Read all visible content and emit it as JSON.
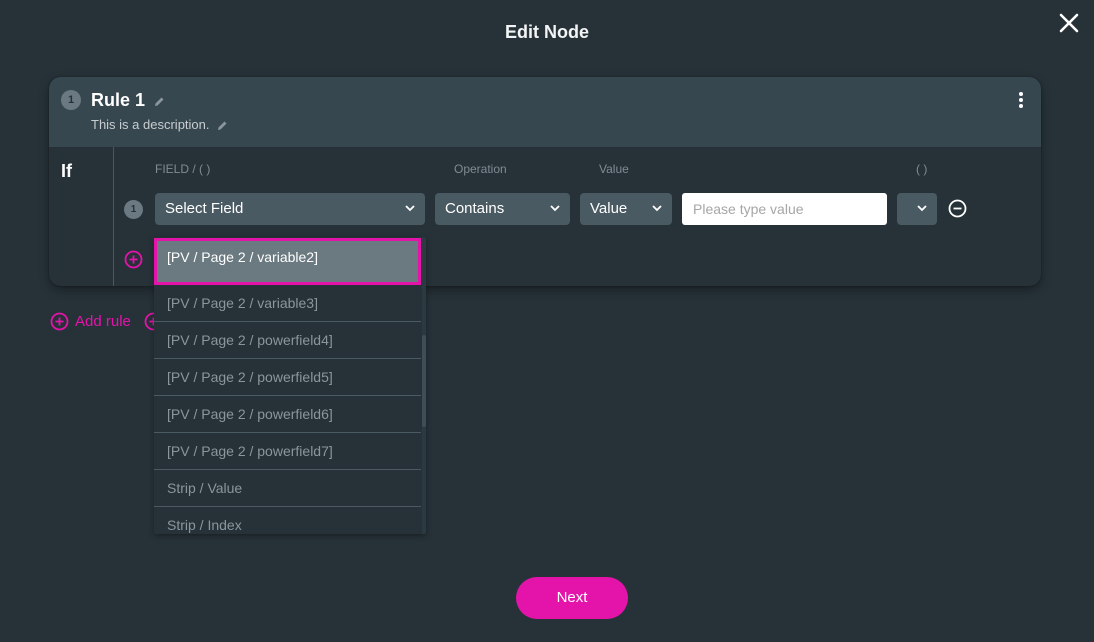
{
  "dialog": {
    "title": "Edit Node",
    "close_icon": "close-icon"
  },
  "rule": {
    "number": "1",
    "name": "Rule 1",
    "description": "This is a description.",
    "menu_icon": "kebab-menu-icon",
    "condition_keyword": "If",
    "columns": {
      "field": "FIELD / ( )",
      "operation": "Operation",
      "value": "Value",
      "paren": "( )"
    },
    "conditions": [
      {
        "number": "1",
        "field": "Select Field",
        "operation": "Contains",
        "value_type": "Value",
        "value_input": "",
        "value_placeholder": "Please type value",
        "paren": ""
      }
    ]
  },
  "field_dropdown": {
    "selected_index": 0,
    "items": [
      "[PV / Page 2 / variable2]",
      "[PV / Page 2 / variable3]",
      "[PV / Page 2 / powerfield4]",
      "[PV / Page 2 / powerfield5]",
      "[PV / Page 2 / powerfield6]",
      "[PV / Page 2 / powerfield7]",
      "Strip / Value",
      "Strip / Index"
    ]
  },
  "actions": {
    "add_rule": "Add rule",
    "next": "Next"
  },
  "colors": {
    "background": "#263238",
    "header": "#37474f",
    "accent": "#e414ab",
    "select_bg": "#4a5a63"
  }
}
